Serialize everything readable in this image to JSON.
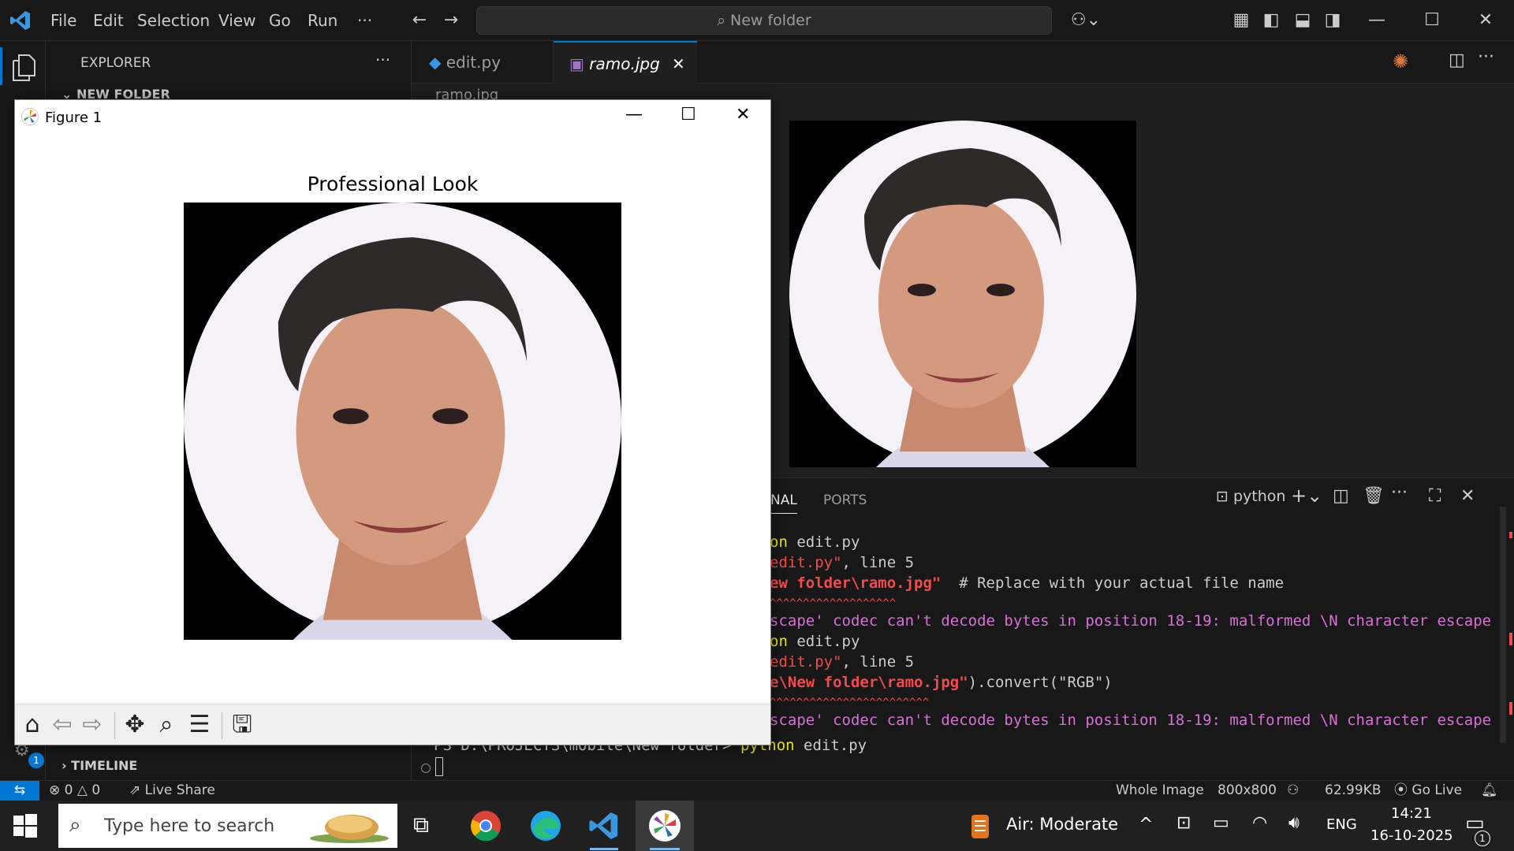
{
  "menu": [
    "File",
    "Edit",
    "Selection",
    "View",
    "Go",
    "Run",
    "···"
  ],
  "search_placeholder": "New folder",
  "explorer": {
    "title": "EXPLORER",
    "folder": "NEW FOLDER",
    "timeline": "TIMELINE"
  },
  "tabs": [
    {
      "label": "edit.py"
    },
    {
      "label": "ramo.jpg"
    }
  ],
  "breadcrumb": "ramo.jpg",
  "panel": {
    "tabs": [
      "NAL",
      "PORTS"
    ],
    "shell": "python",
    "lines": [
      {
        "a": "on ",
        "b": "edit.py",
        "c": "",
        "d": ""
      },
      {
        "a": "edit.py\"",
        "b": ", line 5",
        "c": "",
        "d": ""
      },
      {
        "a": "ew folder\\ramo.jpg\"",
        "b": "  # Replace with your actual file name",
        "c": "",
        "d": ""
      },
      {
        "a": "^^^^^^^^^^^^^^^^^^^",
        "b": "",
        "c": "",
        "d": ""
      },
      {
        "a": "scape' codec can't decode bytes in position 18-19: malformed \\N character escape",
        "b": "",
        "c": "",
        "d": ""
      },
      {
        "a": "on ",
        "b": "edit.py",
        "c": "",
        "d": ""
      },
      {
        "a": "edit.py\"",
        "b": ", line 5",
        "c": "",
        "d": ""
      },
      {
        "a": "e\\New folder\\ramo.jpg\"",
        "b": ").convert(\"RGB\")",
        "c": "",
        "d": ""
      },
      {
        "a": "^^^^^^^^^^^^^^^^^^^^^^^^",
        "b": "",
        "c": "",
        "d": ""
      },
      {
        "a": "scape' codec can't decode bytes in position 18-19: malformed \\N character escape",
        "b": "",
        "c": "",
        "d": ""
      }
    ],
    "prompt": "PS D:\\PROJECTS\\mobile\\New folder> ",
    "prompt_cmd": "python",
    "prompt_arg": " edit.py"
  },
  "status": {
    "errors": "0",
    "warnings": "0",
    "live_share": "Live Share",
    "whole_image": "Whole Image",
    "dims": "800x800",
    "size": "62.99KB",
    "go_live": "Go Live",
    "badge": "1"
  },
  "figure": {
    "title": "Figure 1",
    "plot_title": "Professional Look"
  },
  "taskbar": {
    "search": "Type here to search",
    "weather": "Air: Moderate",
    "lang": "ENG",
    "time": "14:21",
    "date": "16-10-2025",
    "notif": "1"
  },
  "colors": {
    "accent": "#0078d4",
    "orange_text": "#f14c4c",
    "magenta": "#d670d6",
    "yellow": "#e5e510"
  }
}
